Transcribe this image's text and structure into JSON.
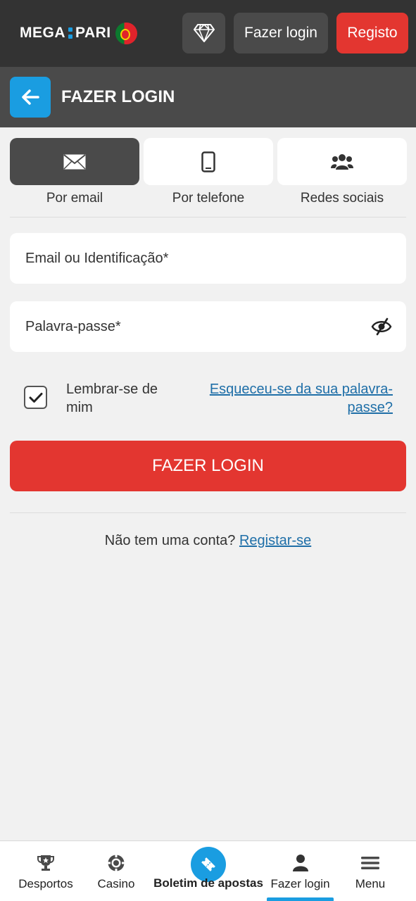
{
  "header": {
    "logo_left": "MEGA",
    "logo_right": "PARI",
    "login_label": "Fazer login",
    "register_label": "Registo"
  },
  "subheader": {
    "title": "FAZER LOGIN"
  },
  "tabs": [
    {
      "label": "Por email",
      "icon": "envelope-icon",
      "active": true
    },
    {
      "label": "Por telefone",
      "icon": "phone-icon",
      "active": false
    },
    {
      "label": "Redes sociais",
      "icon": "users-icon",
      "active": false
    }
  ],
  "form": {
    "email_placeholder": "Email ou Identificação*",
    "password_placeholder": "Palavra-passe*",
    "remember_label": "Lembrar-se de mim",
    "remember_checked": true,
    "forgot_label": "Esqueceu-se da sua palavra-passe?",
    "submit_label": "FAZER LOGIN"
  },
  "signup": {
    "prompt": "Não tem uma conta?",
    "link": "Registar-se"
  },
  "bottom_nav": [
    {
      "label": "Desportos",
      "icon": "trophy-icon"
    },
    {
      "label": "Casino",
      "icon": "casino-chip-icon"
    },
    {
      "label": "Boletim de apostas",
      "icon": "ticket-icon"
    },
    {
      "label": "Fazer login",
      "icon": "user-icon",
      "active": true
    },
    {
      "label": "Menu",
      "icon": "hamburger-icon"
    }
  ],
  "colors": {
    "header_bg": "#333333",
    "subheader_bg": "#4a4a4a",
    "accent_blue": "#1a9de1",
    "accent_red": "#e33630",
    "page_bg": "#f1f1f1"
  }
}
